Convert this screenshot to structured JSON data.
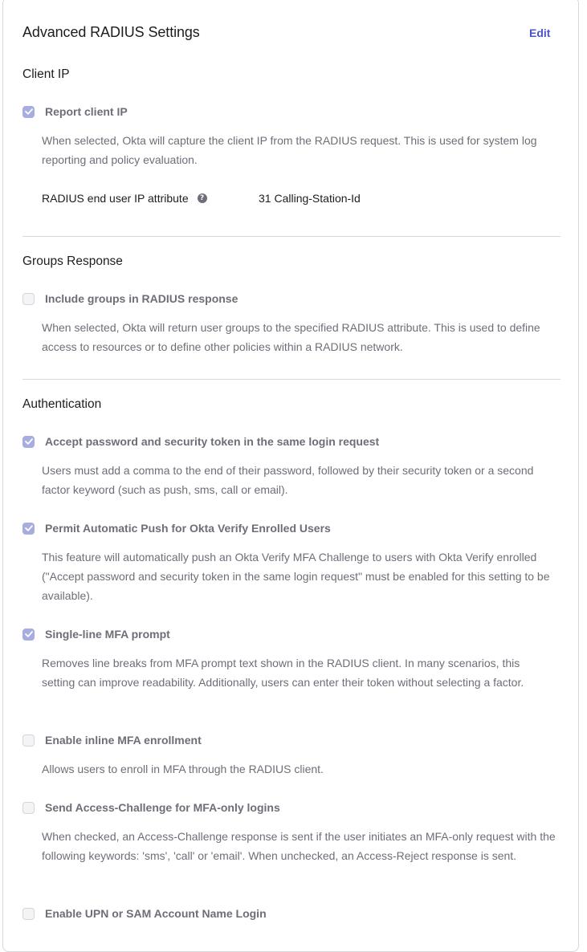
{
  "header": {
    "title": "Advanced RADIUS Settings",
    "edit_label": "Edit"
  },
  "client_ip": {
    "title": "Client IP",
    "report_label": "Report client IP",
    "report_checked": true,
    "report_desc": "When selected, Okta will capture the client IP from the RADIUS request. This is used for system log reporting and policy evaluation.",
    "attr_label": "RADIUS end user IP attribute",
    "attr_help_glyph": "?",
    "attr_value": "31 Calling-Station-Id"
  },
  "groups": {
    "title": "Groups Response",
    "include_label": "Include groups in RADIUS response",
    "include_checked": false,
    "include_desc": "When selected, Okta will return user groups to the specified RADIUS attribute. This is used to define access to resources or to define other policies within a RADIUS network."
  },
  "auth": {
    "title": "Authentication",
    "options": [
      {
        "label": "Accept password and security token in the same login request",
        "checked": true,
        "desc": "Users must add a comma to the end of their password, followed by their security token or a second factor keyword (such as push, sms, call or email)."
      },
      {
        "label": "Permit Automatic Push for Okta Verify Enrolled Users",
        "checked": true,
        "desc": "This feature will automatically push an Okta Verify MFA Challenge to users with Okta Verify enrolled (\"Accept password and security token in the same login request\" must be enabled for this setting to be available)."
      },
      {
        "label": "Single-line MFA prompt",
        "checked": true,
        "desc": "Removes line breaks from MFA prompt text shown in the RADIUS client. In many scenarios, this setting can improve readability. Additionally, users can enter their token without selecting a factor."
      },
      {
        "label": "Enable inline MFA enrollment",
        "checked": false,
        "desc": "Allows users to enroll in MFA through the RADIUS client."
      },
      {
        "label": "Send Access-Challenge for MFA-only logins",
        "checked": false,
        "desc": "When checked, an Access-Challenge response is sent if the user initiates an MFA-only request with the following keywords: 'sms', 'call' or 'email'. When unchecked, an Access-Reject response is sent."
      },
      {
        "label": "Enable UPN or SAM Account Name Login",
        "checked": false,
        "desc": ""
      }
    ]
  },
  "colors": {
    "accent": "#4b55c8",
    "checkbox_checked": "#a7addf",
    "checkbox_unchecked": "#f4f4f6",
    "muted_text": "#6e6e78",
    "divider": "#d7d7dc"
  },
  "icons": {
    "check": "check-icon",
    "help": "help-icon"
  }
}
